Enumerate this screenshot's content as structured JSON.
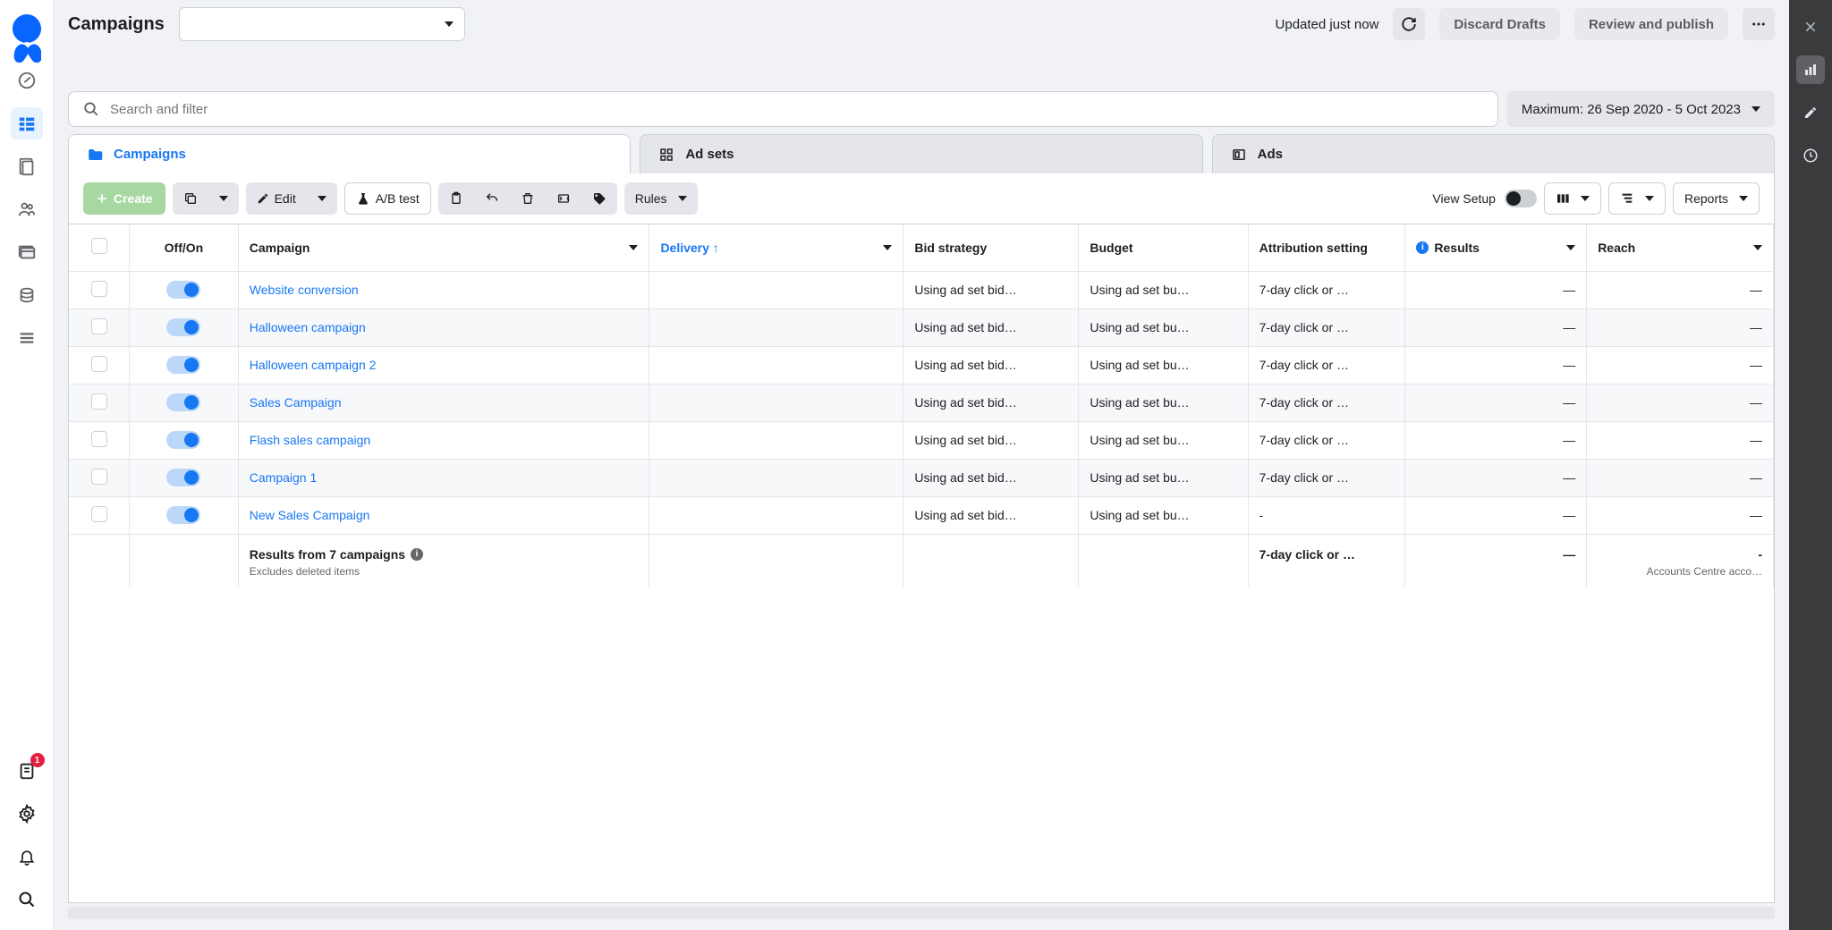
{
  "header": {
    "title": "Campaigns",
    "status": "Updated just now",
    "discard": "Discard Drafts",
    "review": "Review and publish"
  },
  "search": {
    "placeholder": "Search and filter"
  },
  "dateRange": "Maximum: 26 Sep 2020 - 5 Oct 2023",
  "tabs": {
    "campaigns": "Campaigns",
    "adsets": "Ad sets",
    "ads": "Ads"
  },
  "toolbar": {
    "create": "Create",
    "edit": "Edit",
    "abtest": "A/B test",
    "rules": "Rules",
    "viewSetup": "View Setup",
    "reports": "Reports"
  },
  "columns": {
    "offon": "Off/On",
    "campaign": "Campaign",
    "delivery": "Delivery",
    "bid": "Bid strategy",
    "budget": "Budget",
    "attr": "Attribution setting",
    "results": "Results",
    "reach": "Reach"
  },
  "rows": [
    {
      "on": true,
      "name": "Website conversion",
      "bid": "Using ad set bid…",
      "budget": "Using ad set bu…",
      "attr": "7-day click or …",
      "results": "—",
      "reach": "—"
    },
    {
      "on": true,
      "name": "Halloween campaign",
      "bid": "Using ad set bid…",
      "budget": "Using ad set bu…",
      "attr": "7-day click or …",
      "results": "—",
      "reach": "—"
    },
    {
      "on": true,
      "name": "Halloween campaign 2",
      "bid": "Using ad set bid…",
      "budget": "Using ad set bu…",
      "attr": "7-day click or …",
      "results": "—",
      "reach": "—"
    },
    {
      "on": true,
      "name": "Sales Campaign",
      "bid": "Using ad set bid…",
      "budget": "Using ad set bu…",
      "attr": "7-day click or …",
      "results": "—",
      "reach": "—"
    },
    {
      "on": true,
      "name": "Flash sales campaign",
      "bid": "Using ad set bid…",
      "budget": "Using ad set bu…",
      "attr": "7-day click or …",
      "results": "—",
      "reach": "—"
    },
    {
      "on": true,
      "name": "Campaign 1",
      "bid": "Using ad set bid…",
      "budget": "Using ad set bu…",
      "attr": "7-day click or …",
      "results": "—",
      "reach": "—"
    },
    {
      "on": true,
      "name": "New Sales Campaign",
      "bid": "Using ad set bid…",
      "budget": "Using ad set bu…",
      "attr": "-",
      "results": "—",
      "reach": "—"
    }
  ],
  "summary": {
    "title": "Results from 7 campaigns",
    "sub": "Excludes deleted items",
    "attr": "7-day click or …",
    "results": "—",
    "reach": "-",
    "reachSub": "Accounts Centre acco…"
  },
  "leftNav": {
    "badge": "1"
  }
}
